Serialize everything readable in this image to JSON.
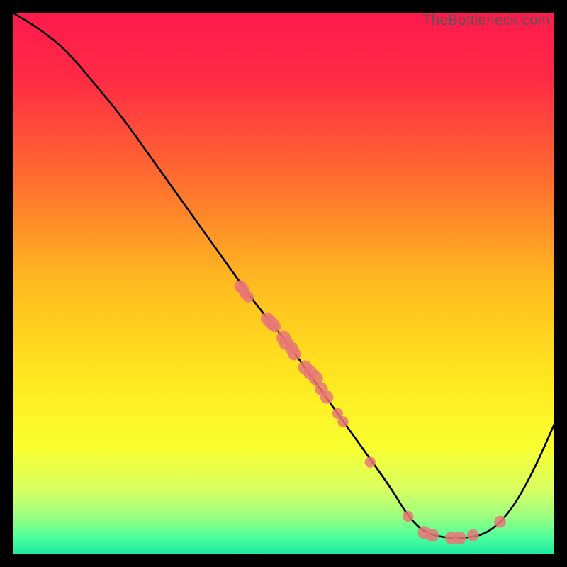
{
  "watermark": "TheBottleneck.com",
  "chart_data": {
    "type": "line",
    "title": "",
    "xlabel": "",
    "ylabel": "",
    "xlim": [
      0,
      100
    ],
    "ylim": [
      0,
      100
    ],
    "curve": {
      "name": "bottleneck-curve",
      "x": [
        0,
        5,
        10,
        15,
        20,
        25,
        30,
        35,
        40,
        45,
        50,
        55,
        60,
        65,
        70,
        73,
        76,
        80,
        84,
        88,
        92,
        96,
        100
      ],
      "y": [
        100,
        97,
        93,
        87,
        81,
        74,
        67,
        60,
        53,
        46,
        40,
        33,
        26,
        19,
        12,
        7,
        4,
        3,
        3,
        4,
        8,
        15,
        24
      ]
    },
    "scatter": {
      "name": "datapoints",
      "color": "#e77777",
      "points": [
        {
          "x": 42,
          "y": 49.5,
          "r": 1.1
        },
        {
          "x": 42.5,
          "y": 49,
          "r": 1.1
        },
        {
          "x": 43,
          "y": 48,
          "r": 1.0
        },
        {
          "x": 43.5,
          "y": 47.5,
          "r": 1.0
        },
        {
          "x": 47,
          "y": 43.5,
          "r": 1.2
        },
        {
          "x": 47.5,
          "y": 43,
          "r": 1.2
        },
        {
          "x": 48,
          "y": 42.5,
          "r": 1.2
        },
        {
          "x": 48.5,
          "y": 42,
          "r": 1.0
        },
        {
          "x": 50,
          "y": 40,
          "r": 1.3
        },
        {
          "x": 50.5,
          "y": 39,
          "r": 1.3
        },
        {
          "x": 51.5,
          "y": 38,
          "r": 1.2
        },
        {
          "x": 52,
          "y": 37,
          "r": 1.2
        },
        {
          "x": 54,
          "y": 34.5,
          "r": 1.3
        },
        {
          "x": 55,
          "y": 33.5,
          "r": 1.3
        },
        {
          "x": 56,
          "y": 32.5,
          "r": 1.3
        },
        {
          "x": 57,
          "y": 30.5,
          "r": 1.2
        },
        {
          "x": 58,
          "y": 29,
          "r": 1.2
        },
        {
          "x": 60,
          "y": 26,
          "r": 1.0
        },
        {
          "x": 61,
          "y": 24.5,
          "r": 1.0
        },
        {
          "x": 66,
          "y": 17,
          "r": 1.0
        },
        {
          "x": 73,
          "y": 7,
          "r": 1.0
        },
        {
          "x": 76,
          "y": 4,
          "r": 1.2
        },
        {
          "x": 77.5,
          "y": 3.5,
          "r": 1.2
        },
        {
          "x": 81,
          "y": 3,
          "r": 1.2
        },
        {
          "x": 82.5,
          "y": 3,
          "r": 1.2
        },
        {
          "x": 85,
          "y": 3.5,
          "r": 1.1
        },
        {
          "x": 90,
          "y": 6,
          "r": 1.1
        }
      ]
    },
    "gradient_stops": [
      {
        "offset": 0,
        "color": "#ff1a4d"
      },
      {
        "offset": 0.12,
        "color": "#ff2a45"
      },
      {
        "offset": 0.3,
        "color": "#ff6a30"
      },
      {
        "offset": 0.5,
        "color": "#ffbb20"
      },
      {
        "offset": 0.68,
        "color": "#ffe820"
      },
      {
        "offset": 0.8,
        "color": "#faff30"
      },
      {
        "offset": 0.88,
        "color": "#d8ff60"
      },
      {
        "offset": 0.93,
        "color": "#9cff80"
      },
      {
        "offset": 0.97,
        "color": "#4cff9c"
      },
      {
        "offset": 1.0,
        "color": "#1de9a0"
      }
    ]
  }
}
